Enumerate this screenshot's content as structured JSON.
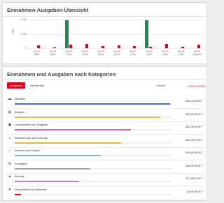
{
  "overview": {
    "title": "Einnahmen-Ausgaben-Übersicht",
    "axis_unit": "EUR"
  },
  "chart_data": {
    "type": "bar",
    "title": "Einnahmen-Ausgaben-Übersicht",
    "ylabel": "EUR",
    "ylim": [
      0,
      2000
    ],
    "yticks": [
      "2.000",
      "1.000",
      "0"
    ],
    "categories": [
      [
        "KW 21",
        "(Mai)"
      ],
      [
        "KW 22",
        "(Mai)"
      ],
      [
        "KW 23",
        "(Juni)"
      ],
      [
        "KW 24",
        "(Juni)"
      ],
      [
        "KW 25",
        "(Juni)"
      ],
      [
        "KW 26",
        "(Juni)"
      ],
      [
        "KW 27",
        "(Juli)"
      ],
      [
        "KW 28",
        "(Juli)"
      ],
      [
        "KW 29",
        "(Juli)"
      ],
      [
        "KW 30",
        "(Juli)"
      ],
      [
        "KW 31",
        "(August)"
      ]
    ],
    "series": [
      {
        "values": [
          0,
          0,
          1960,
          0,
          0,
          0,
          0,
          1960,
          0,
          0,
          0
        ],
        "color": "#1b8a4a"
      },
      {
        "values": [
          190,
          40,
          230,
          300,
          150,
          210,
          140,
          120,
          300,
          120,
          260
        ],
        "color": "#e2001a"
      }
    ]
  },
  "categories_section": {
    "title": "Einnahmen und Ausgaben nach Kategorien",
    "tab_expenses": "Ausgaben",
    "tab_income": "Einnahmen",
    "total_label": "Gesamt:",
    "total_value": "-2.594,20 EUR",
    "rows": [
      {
        "icon": "car-icon",
        "glyph": "▬",
        "label": "Mobilität",
        "amount": "-535,13 EUR",
        "share": 0.99,
        "color": "#4a6cc9"
      },
      {
        "icon": "bank-icon",
        "glyph": "▤",
        "label": "Bargeld",
        "amount": "-500,00 EUR",
        "share": 0.93,
        "color": "#e9c233"
      },
      {
        "icon": "cart-icon",
        "glyph": "▣",
        "label": "Lebensmittel und Drogerie",
        "amount": "-400,30 EUR",
        "share": 0.74,
        "color": "#d861b8"
      },
      {
        "icon": "umbrella-icon",
        "glyph": "◒",
        "label": "Absicherung und Vorsorge",
        "amount": "-364,32 EUR",
        "share": 0.68,
        "color": "#e5b73b"
      },
      {
        "icon": "house-icon",
        "glyph": "⌂",
        "label": "Wohnen und Garten",
        "amount": "-293,00 EUR",
        "share": 0.55,
        "color": "#5bc3d3"
      },
      {
        "icon": "gear-icon",
        "glyph": "⚙",
        "label": "Sonstiges",
        "amount": "-258,00 EUR",
        "share": 0.48,
        "color": "#a6a6a6"
      },
      {
        "icon": "graduation-cap-icon",
        "glyph": "▲",
        "label": "Bildung",
        "amount": "-222,84 EUR",
        "share": 0.41,
        "color": "#c985d3"
      },
      {
        "icon": "heart-icon",
        "glyph": "♥",
        "label": "Gesundheit und Wellness",
        "amount": "-20,00 EUR",
        "share": 0.04,
        "color": "#e2001a"
      }
    ]
  }
}
